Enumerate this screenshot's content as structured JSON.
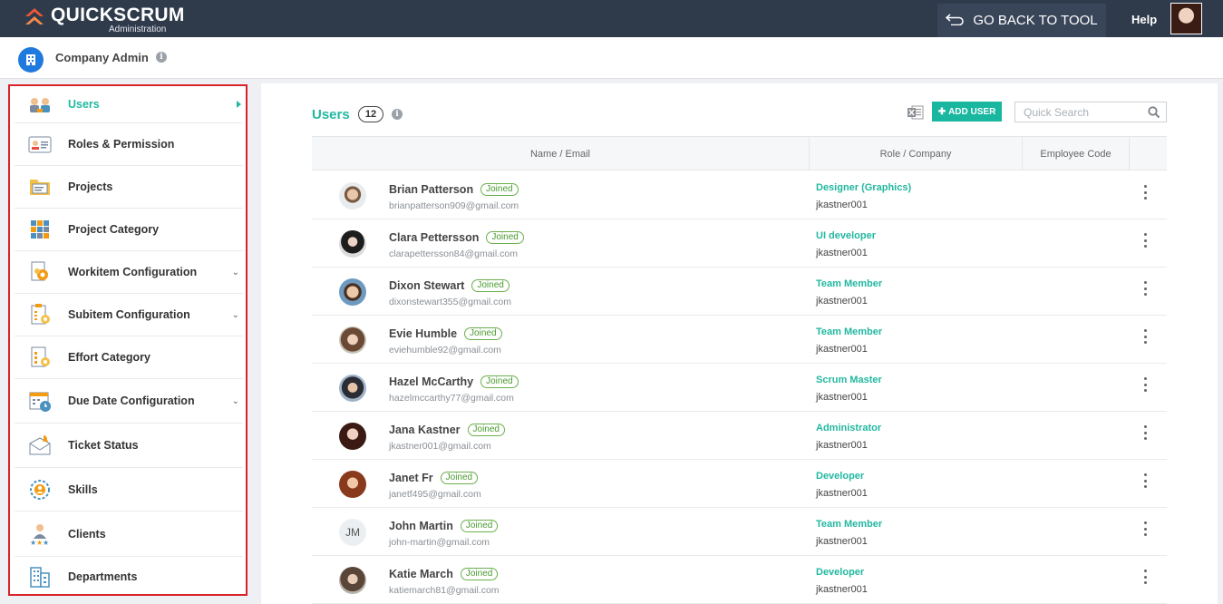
{
  "app": {
    "logo_text": "Quickscrum",
    "logo_sub": "Administration"
  },
  "topbar": {
    "go_back_label": "GO BACK TO TOOL",
    "help_label": "Help"
  },
  "subheader": {
    "title": "Company Admin"
  },
  "sidebar": {
    "items": [
      {
        "label": "Users",
        "icon": "users-icon",
        "active": true
      },
      {
        "label": "Roles & Permission",
        "icon": "id-card-icon"
      },
      {
        "label": "Projects",
        "icon": "folder-icon"
      },
      {
        "label": "Project Category",
        "icon": "grid-icon"
      },
      {
        "label": "Workitem Configuration",
        "icon": "gear-document-icon",
        "expandable": true
      },
      {
        "label": "Subitem Configuration",
        "icon": "clipboard-gear-icon",
        "expandable": true
      },
      {
        "label": "Effort Category",
        "icon": "document-gear-icon"
      },
      {
        "label": "Due Date Configuration",
        "icon": "calendar-clock-icon",
        "expandable": true
      },
      {
        "label": "Ticket Status",
        "icon": "ticket-bell-icon"
      },
      {
        "label": "Skills",
        "icon": "skills-badge-icon"
      },
      {
        "label": "Clients",
        "icon": "client-rating-icon"
      },
      {
        "label": "Departments",
        "icon": "building-icon"
      }
    ]
  },
  "main": {
    "title": "Users",
    "count": "12",
    "add_user_label": "ADD USER",
    "search_placeholder": "Quick Search",
    "columns": [
      "Name / Email",
      "Role / Company",
      "Employee Code"
    ],
    "users": [
      {
        "name": "Brian Patterson",
        "status": "Joined",
        "email": "brianpatterson909@gmail.com",
        "role": "Designer (Graphics)",
        "company": "jkastner001"
      },
      {
        "name": "Clara Pettersson",
        "status": "Joined",
        "email": "clarapettersson84@gmail.com",
        "role": "UI developer",
        "company": "jkastner001"
      },
      {
        "name": "Dixon Stewart",
        "status": "Joined",
        "email": "dixonstewart355@gmail.com",
        "role": "Team Member",
        "company": "jkastner001"
      },
      {
        "name": "Evie Humble",
        "status": "Joined",
        "email": "eviehumble92@gmail.com",
        "role": "Team Member",
        "company": "jkastner001"
      },
      {
        "name": "Hazel McCarthy",
        "status": "Joined",
        "email": "hazelmccarthy77@gmail.com",
        "role": "Scrum Master",
        "company": "jkastner001"
      },
      {
        "name": "Jana Kastner",
        "status": "Joined",
        "email": "jkastner001@gmail.com",
        "role": "Administrator",
        "company": "jkastner001"
      },
      {
        "name": "Janet Fr",
        "status": "Joined",
        "email": "janetf495@gmail.com",
        "role": "Developer",
        "company": "jkastner001"
      },
      {
        "name": "John Martin",
        "status": "Joined",
        "email": "john-martin@gmail.com",
        "role": "Team Member",
        "company": "jkastner001",
        "initials": "JM"
      },
      {
        "name": "Katie March",
        "status": "Joined",
        "email": "katiemarch81@gmail.com",
        "role": "Developer",
        "company": "jkastner001"
      }
    ]
  },
  "colors": {
    "topbar": "#2f3a4b",
    "accent": "#22b8a0",
    "highlight_border": "#d8232a",
    "badge": "#6ab04c"
  }
}
